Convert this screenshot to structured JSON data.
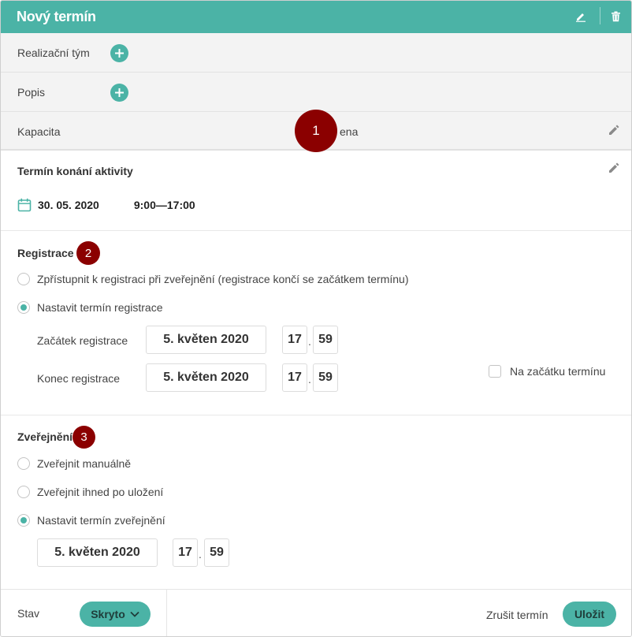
{
  "header": {
    "title": "Nový termín"
  },
  "rows": [
    {
      "label": "Realizační tým"
    },
    {
      "label": "Popis"
    },
    {
      "label": "Kapacita",
      "value": "ena"
    }
  ],
  "badges": [
    "1",
    "2",
    "3"
  ],
  "term": {
    "title": "Termín konání aktivity",
    "date": "30. 05. 2020",
    "time": "9:00—17:00"
  },
  "registration": {
    "title": "Registrace",
    "option_publish": "Zpřístupnit k registraci při zveřejnění (registrace končí se začátkem termínu)",
    "option_custom": "Nastavit termín registrace",
    "start": {
      "label": "Začátek registrace",
      "date": "5. květen 2020",
      "hour": "17",
      "minute": "59"
    },
    "end": {
      "label": "Konec registrace",
      "date": "5. květen 2020",
      "hour": "17",
      "minute": "59"
    },
    "at_start_checkbox": "Na začátku termínu"
  },
  "publishing": {
    "title": "Zveřejnění",
    "option_manual": "Zveřejnit manuálně",
    "option_immediate": "Zveřejnit ihned po uložení",
    "option_scheduled": "Nastavit termín zveřejnění",
    "date": "5. květen 2020",
    "hour": "17",
    "minute": "59"
  },
  "footer": {
    "status_label": "Stav",
    "status_value": "Skryto",
    "cancel": "Zrušit termín",
    "save": "Uložit"
  },
  "colors": {
    "accent": "#4bb3a6",
    "badge": "#8b0000"
  },
  "icons": [
    "pencil-icon",
    "trash-icon",
    "plus-icon",
    "calendar-icon",
    "chevron-down-icon"
  ]
}
